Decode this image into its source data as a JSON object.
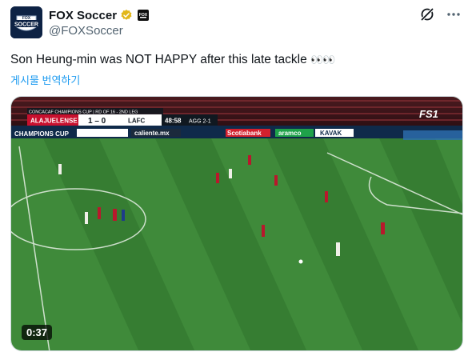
{
  "account": {
    "display_name": "FOX Soccer",
    "handle": "@FOXSoccer",
    "avatar_icon": "fox-soccer-logo",
    "verified_color": "#e2b719"
  },
  "tweet": {
    "text": "Son Heung-min was NOT HAPPY after this late tackle",
    "emoji": "👀👀",
    "translate_label": "게시물 번역하기"
  },
  "video": {
    "duration": "0:37",
    "scoreboard": {
      "competition": "CONCACAF CHAMPIONS CUP | RD OF 16 - 2ND LEG",
      "home_team": "ALAJUELENSE",
      "score": "1 – 0",
      "away_team": "LAFC",
      "clock": "48:58",
      "aggregate": "AGG 2-1"
    },
    "broadcaster": "FS1",
    "ads": [
      "CHAMPIONS CUP",
      "caliente.mx",
      "Scotiabank",
      "aramco",
      "KAVAK"
    ]
  },
  "colors": {
    "accent": "#1d9bf0",
    "pitch_light": "#3f8a3a",
    "pitch_dark": "#357a31",
    "home_red": "#c8102e"
  }
}
